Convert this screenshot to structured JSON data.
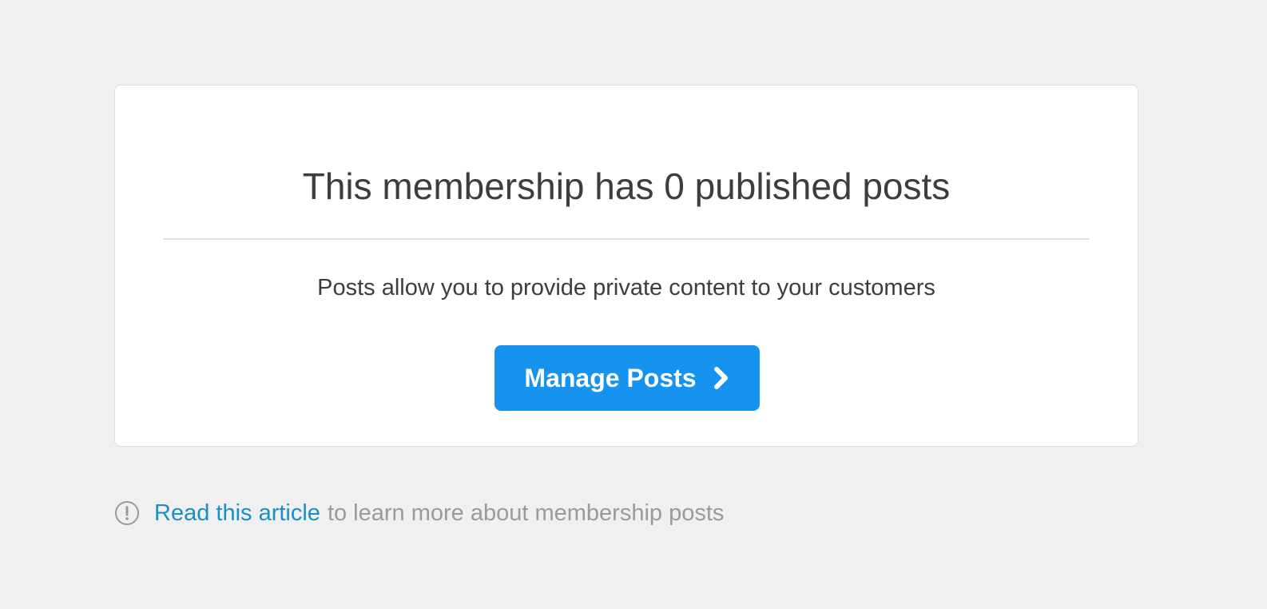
{
  "card": {
    "title": "This membership has 0 published posts",
    "description": "Posts allow you to provide private content to your customers",
    "button_label": "Manage Posts",
    "button_icon": "chevron-right-icon",
    "button_color": "#1593ee"
  },
  "footer": {
    "icon": "info-icon",
    "link_text": "Read this article",
    "rest_text": "to learn more about membership posts",
    "link_color": "#1a8fc4"
  }
}
